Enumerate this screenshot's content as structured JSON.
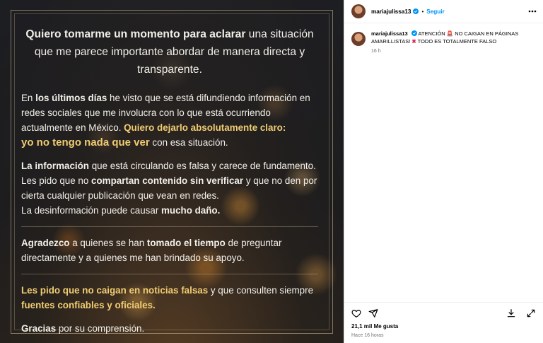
{
  "post_image": {
    "heading": {
      "part1": "Quiero tomarme un momento para aclarar",
      "part2": " una situación que me parece importante abordar de manera directa y transparente."
    },
    "para1": {
      "a": "En ",
      "b": "los últimos días",
      "c": " he visto que se está difundiendo información en redes sociales que me involucra con lo que está ocurriendo actualmente en México. ",
      "d": "Quiero dejarlo absolutamente claro:",
      "e": "yo no tengo nada que ver",
      "f": " con esa situación."
    },
    "para2": {
      "a": "La información",
      "b": " que está circulando es falsa y carece de fundamento.",
      "c": "Les pido que no ",
      "d": "compartan contenido sin verificar",
      "e": " y que no den por cierta cualquier publicación que vean en redes.",
      "f": "La desinformación puede causar ",
      "g": "mucho daño."
    },
    "para3": {
      "a": "Agradezco",
      "b": " a quienes se han ",
      "c": "tomado el tiempo",
      "d": " de preguntar directamente y a quienes me han brindado su apoyo."
    },
    "para4": {
      "a": "Les pido que no caigan en noticias falsas",
      "b": " y que consulten siempre ",
      "c": "fuentes confiables y oficiales."
    },
    "closing": {
      "a": "Gracias",
      "b": " por su comprensión."
    }
  },
  "header": {
    "username": "mariajulissa13",
    "separator": "•",
    "follow_label": "Seguir"
  },
  "caption": {
    "username": "mariajulissa13",
    "text_part1": " ATENCIÓN",
    "text_part2": " NO CAIGAN EN PÁGINAS AMARILLISTAS! ",
    "text_part3": " TODO ES TOTALMENTE FALSO",
    "time": "16 h"
  },
  "footer": {
    "likes": "21,1 mil Me gusta",
    "time_ago": "Hace 16 horas"
  },
  "colors": {
    "accent": "#0095f6",
    "gold_text": "#f0cc72",
    "muted": "#737373"
  },
  "icons": [
    "verified-badge-icon",
    "more-options-icon",
    "heart-icon",
    "share-icon",
    "download-icon",
    "expand-icon"
  ]
}
